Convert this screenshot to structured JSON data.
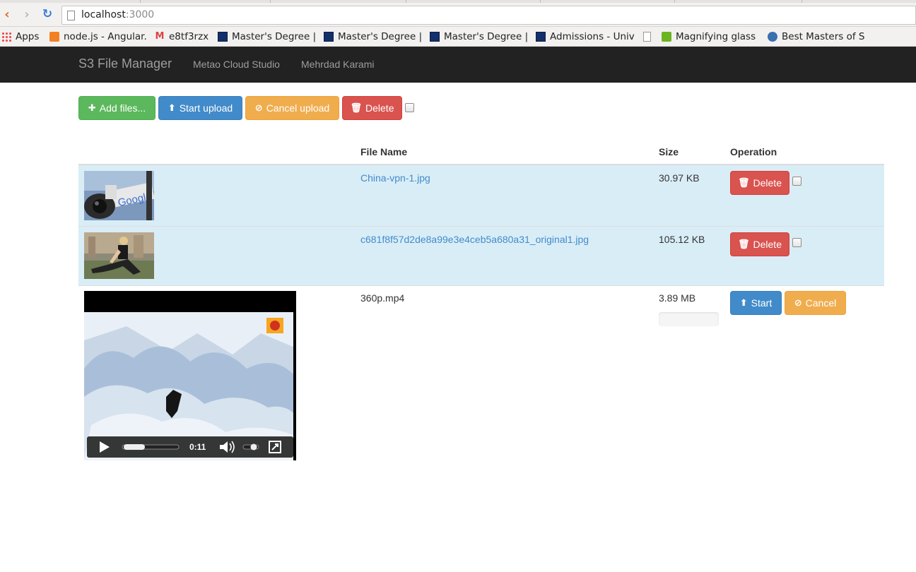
{
  "browser": {
    "url_host": "localhost",
    "url_port": ":3000",
    "bookmarks": [
      {
        "label": "Apps",
        "icon": "apps-grid-icon"
      },
      {
        "label": "node.js - Angular.",
        "icon": "stackoverflow-icon"
      },
      {
        "label": "e8tf3rzx",
        "icon": "gmail-icon"
      },
      {
        "label": "Master's Degree |",
        "icon": "university-icon"
      },
      {
        "label": "Master's Degree |",
        "icon": "university-icon"
      },
      {
        "label": "Master's Degree |",
        "icon": "university-icon"
      },
      {
        "label": "Admissions - Univ",
        "icon": "university-icon"
      },
      {
        "label": "",
        "icon": "document-icon"
      },
      {
        "label": "Magnifying glass",
        "icon": "play-icon"
      },
      {
        "label": "Best Masters of S",
        "icon": "globe-icon"
      }
    ]
  },
  "navbar": {
    "brand": "S3 File Manager",
    "links": [
      "Metao Cloud Studio",
      "Mehrdad Karami"
    ]
  },
  "toolbar": {
    "add_files": "Add files...",
    "start_upload": "Start upload",
    "cancel_upload": "Cancel upload",
    "delete": "Delete"
  },
  "table": {
    "headers": {
      "file_name": "File Name",
      "size": "Size",
      "operation": "Operation"
    },
    "rows": [
      {
        "name": "China-vpn-1.jpg",
        "size": "30.97 KB",
        "action": "Delete",
        "status": "uploaded"
      },
      {
        "name": "c681f8f57d2de8a99e3e4ceb5a680a31_original1.jpg",
        "size": "105.12 KB",
        "action": "Delete",
        "status": "uploaded"
      },
      {
        "name": "360p.mp4",
        "size": "3.89 MB",
        "start": "Start",
        "cancel": "Cancel",
        "status": "pending",
        "progress": 0
      }
    ]
  },
  "video": {
    "time": "0:11"
  },
  "colors": {
    "navbar": "#222222",
    "success": "#5cb85c",
    "primary": "#428bca",
    "warning": "#f0ad4e",
    "danger": "#d9534f",
    "row_uploaded": "#d9edf7"
  }
}
